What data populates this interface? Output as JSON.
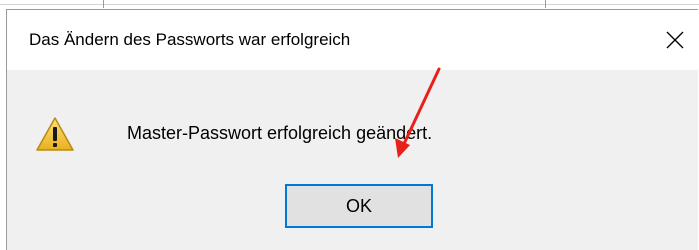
{
  "dialog": {
    "title": "Das Ändern des Passworts war erfolgreich",
    "message": "Master-Passwort erfolgreich geändert.",
    "ok_label": "OK",
    "close_icon": "close-icon",
    "message_icon": "warning-icon"
  },
  "colors": {
    "dialog_body": "#f0f0f0",
    "titlebar": "#ffffff",
    "button_focus_border": "#0078d7",
    "button_face": "#e1e1e1",
    "warning_fill": "#f7c948",
    "annotation_arrow": "#e8201a"
  }
}
